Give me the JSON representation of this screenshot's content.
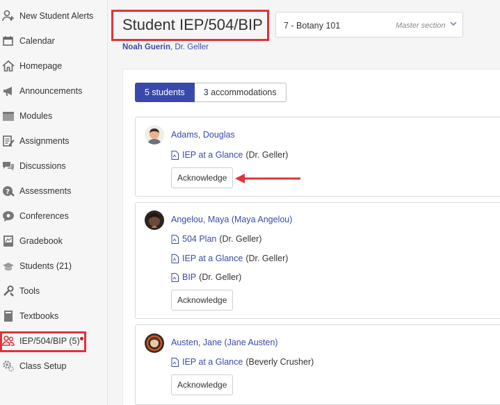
{
  "sidebar": {
    "items": [
      {
        "label": "New Student Alerts",
        "icon": "new-student-alerts-icon"
      },
      {
        "label": "Calendar",
        "icon": "calendar-icon"
      },
      {
        "label": "Homepage",
        "icon": "home-icon"
      },
      {
        "label": "Announcements",
        "icon": "megaphone-icon"
      },
      {
        "label": "Modules",
        "icon": "modules-icon"
      },
      {
        "label": "Assignments",
        "icon": "assignments-icon"
      },
      {
        "label": "Discussions",
        "icon": "discussions-icon"
      },
      {
        "label": "Assessments",
        "icon": "assessments-icon"
      },
      {
        "label": "Conferences",
        "icon": "conferences-icon"
      },
      {
        "label": "Gradebook",
        "icon": "gradebook-icon"
      },
      {
        "label": "Students (21)",
        "icon": "students-icon"
      },
      {
        "label": "Tools",
        "icon": "tools-icon"
      },
      {
        "label": "Textbooks",
        "icon": "textbooks-icon"
      },
      {
        "label": "IEP/504/BIP (5)",
        "icon": "iep-icon"
      },
      {
        "label": "Class Setup",
        "icon": "class-setup-icon"
      }
    ]
  },
  "header": {
    "title": "Student IEP/504/BIP",
    "section_value": "7 - Botany 101",
    "section_hint": "Master section",
    "teacher_primary": "Noah Guerin",
    "teacher_sep": ",",
    "teacher_secondary": "Dr. Geller"
  },
  "toggle": {
    "students_label": "5 students",
    "accommodations_label": "3 accommodations"
  },
  "students": [
    {
      "name": "Adams, Douglas",
      "documents": [
        {
          "name": "IEP at a Glance",
          "author": "(Dr. Geller)"
        }
      ],
      "ack_label": "Acknowledge"
    },
    {
      "name": "Angelou, Maya (Maya Angelou)",
      "documents": [
        {
          "name": "504 Plan",
          "author": "(Dr. Geller)"
        },
        {
          "name": "IEP at a Glance",
          "author": "(Dr. Geller)"
        },
        {
          "name": "BIP",
          "author": "(Dr. Geller)"
        }
      ],
      "ack_label": "Acknowledge"
    },
    {
      "name": "Austen, Jane (Jane Austen)",
      "documents": [
        {
          "name": "IEP at a Glance",
          "author": "(Beverly Crusher)"
        }
      ],
      "ack_label": "Acknowledge"
    }
  ],
  "colors": {
    "accent": "#3949ab",
    "link": "#3a4aa7",
    "highlight": "#e0323a"
  }
}
